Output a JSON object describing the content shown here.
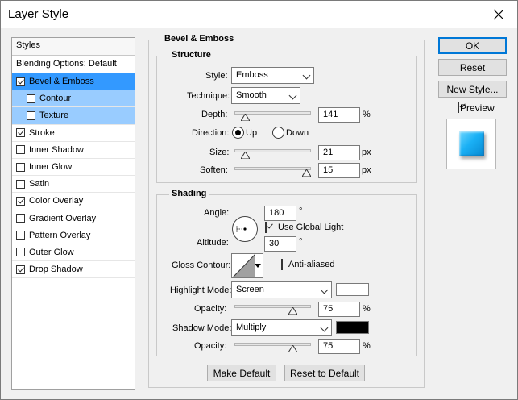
{
  "window": {
    "title": "Layer Style"
  },
  "styles_panel": {
    "header": "Styles",
    "blending_label": "Blending Options: Default",
    "items": [
      {
        "label": "Bevel & Emboss",
        "checked": true
      },
      {
        "label": "Contour",
        "checked": false
      },
      {
        "label": "Texture",
        "checked": false
      },
      {
        "label": "Stroke",
        "checked": true
      },
      {
        "label": "Inner Shadow",
        "checked": false
      },
      {
        "label": "Inner Glow",
        "checked": false
      },
      {
        "label": "Satin",
        "checked": false
      },
      {
        "label": "Color Overlay",
        "checked": true
      },
      {
        "label": "Gradient Overlay",
        "checked": false
      },
      {
        "label": "Pattern Overlay",
        "checked": false
      },
      {
        "label": "Outer Glow",
        "checked": false
      },
      {
        "label": "Drop Shadow",
        "checked": true
      }
    ]
  },
  "bevel": {
    "title": "Bevel & Emboss",
    "structure": {
      "title": "Structure",
      "style_label": "Style:",
      "style_value": "Emboss",
      "technique_label": "Technique:",
      "technique_value": "Smooth",
      "depth_label": "Depth:",
      "depth_value": "141",
      "depth_unit": "%",
      "direction_label": "Direction:",
      "direction_up": "Up",
      "direction_down": "Down",
      "size_label": "Size:",
      "size_value": "21",
      "size_unit": "px",
      "soften_label": "Soften:",
      "soften_value": "15",
      "soften_unit": "px"
    },
    "shading": {
      "title": "Shading",
      "angle_label": "Angle:",
      "angle_value": "180",
      "angle_unit": "°",
      "global_light_label": "Use Global Light",
      "altitude_label": "Altitude:",
      "altitude_value": "30",
      "altitude_unit": "°",
      "gloss_label": "Gloss Contour:",
      "anti_alias_label": "Anti-aliased",
      "highlight_mode_label": "Highlight Mode:",
      "highlight_mode_value": "Screen",
      "highlight_opacity_label": "Opacity:",
      "highlight_opacity_value": "75",
      "highlight_opacity_unit": "%",
      "shadow_mode_label": "Shadow Mode:",
      "shadow_mode_value": "Multiply",
      "shadow_opacity_label": "Opacity:",
      "shadow_opacity_value": "75",
      "shadow_opacity_unit": "%",
      "highlight_color": "#ffffff",
      "shadow_color": "#000000"
    },
    "make_default": "Make Default",
    "reset_default": "Reset to Default"
  },
  "buttons": {
    "ok": "OK",
    "reset": "Reset",
    "new_style": "New Style...",
    "preview_label": "Preview"
  },
  "colors": {
    "selected": "#3399ff",
    "preview_fill": "#1ab0f5"
  }
}
